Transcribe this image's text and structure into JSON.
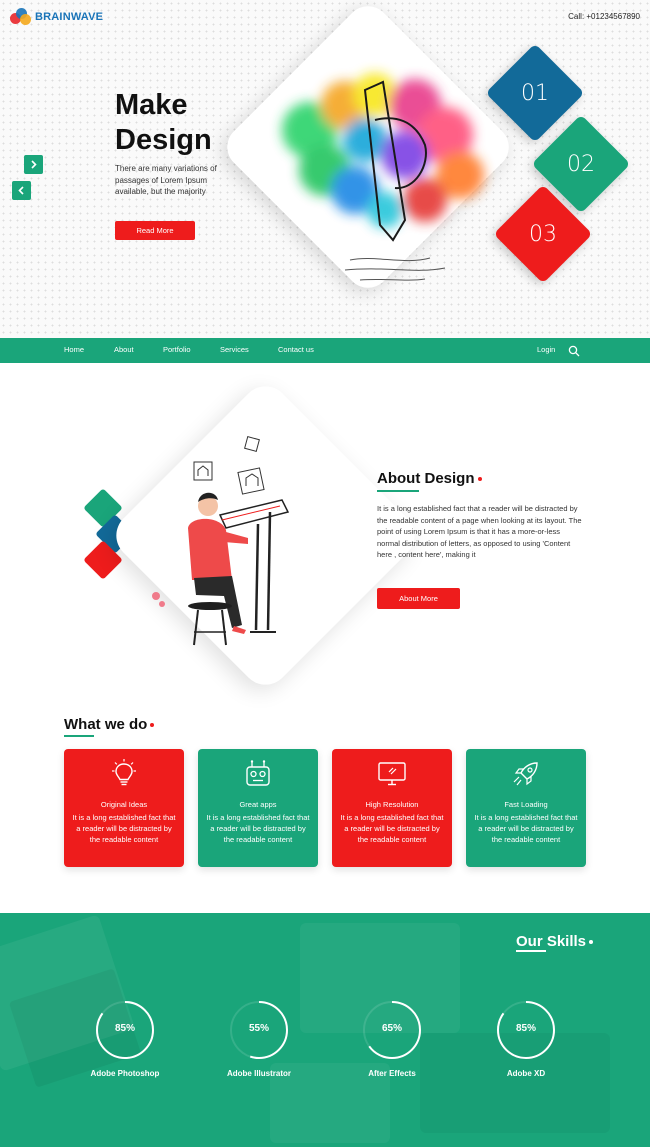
{
  "brand": {
    "name": "BRAINWAVE",
    "colors": {
      "teal": "#1aa57a",
      "red": "#ee1c1c",
      "blue": "#126a99"
    }
  },
  "header": {
    "call": "Call: +01234567890"
  },
  "hero": {
    "title_line1": "Make",
    "title_line2": "Design",
    "text": "There are many variations of passages of Lorem Ipsum available, but the majority",
    "read_more": "Read More",
    "next_icon": "chevron-right-icon",
    "prev_icon": "chevron-left-icon",
    "tiles": [
      "01",
      "02",
      "03"
    ]
  },
  "nav": {
    "items": [
      "Home",
      "About",
      "Portfolio",
      "Services",
      "Contact us"
    ],
    "login": "Login",
    "search_icon": "search-icon"
  },
  "about": {
    "heading": "About Design",
    "text": "It is a long established fact that a reader will be distracted by the readable content of a page when looking at its layout. The point of using Lorem Ipsum is that it has a more-or-less normal distribution of letters, as opposed to using 'Content here , content here', making it",
    "button": "About More"
  },
  "what_we_do": {
    "heading": "What we do",
    "cards": [
      {
        "title": "Original Ideas",
        "text": "It is a long established fact that a reader will be distracted by the readable content",
        "icon": "lightbulb-icon"
      },
      {
        "title": "Great apps",
        "text": "It is a long established fact that a reader will be distracted by the readable content",
        "icon": "robot-icon"
      },
      {
        "title": "High Resolution",
        "text": "It is a long established fact that a reader will be distracted by the readable content",
        "icon": "monitor-icon"
      },
      {
        "title": "Fast Loading",
        "text": "It is a long established fact that a reader will be distracted by the readable content",
        "icon": "rocket-icon"
      }
    ]
  },
  "skills": {
    "heading": "Our Skills",
    "items": [
      {
        "name": "Adobe Photoshop",
        "percent": "85%",
        "value": 0.85
      },
      {
        "name": "Adobe Illustrator",
        "percent": "55%",
        "value": 0.55
      },
      {
        "name": "After Effects",
        "percent": "65%",
        "value": 0.65
      },
      {
        "name": "Adobe XD",
        "percent": "85%",
        "value": 0.85
      }
    ]
  }
}
